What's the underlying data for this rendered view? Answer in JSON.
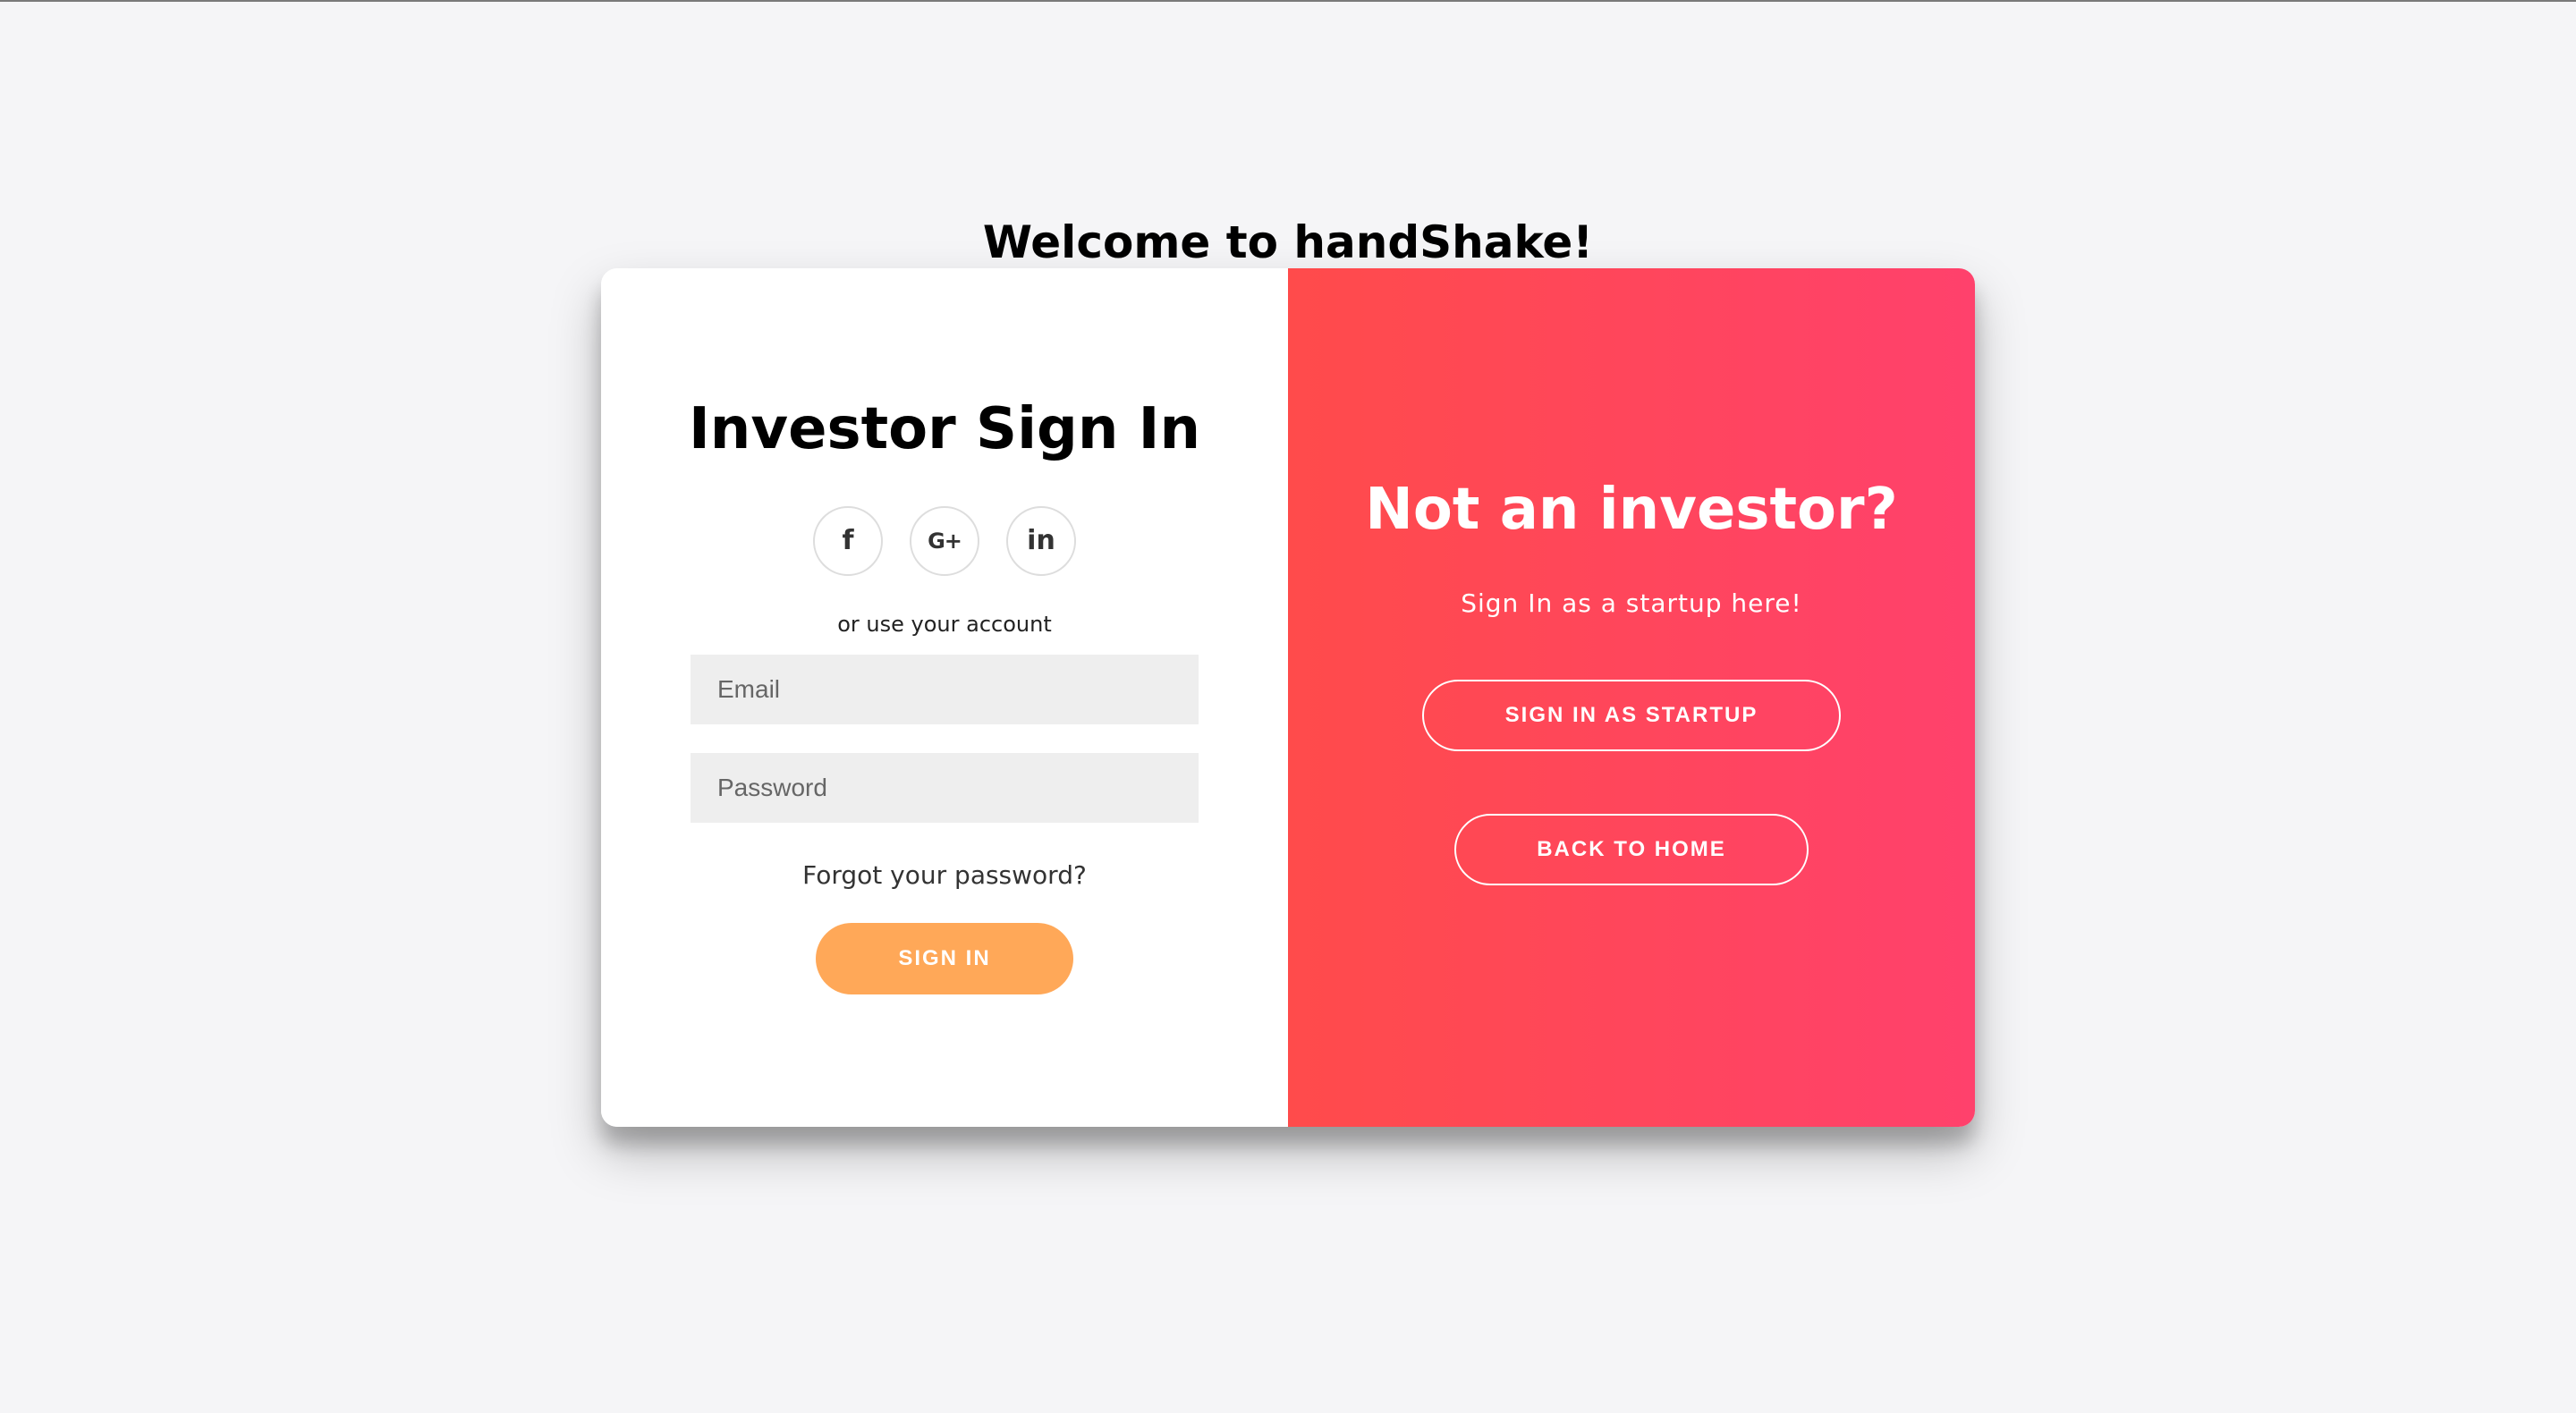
{
  "page": {
    "welcome_title": "Welcome to handShake!"
  },
  "signin_panel": {
    "title": "Investor Sign In",
    "social_buttons": [
      {
        "icon": "facebook-icon",
        "label": "f"
      },
      {
        "icon": "google-plus-icon",
        "label": "G+"
      },
      {
        "icon": "linkedin-icon",
        "label": "in"
      }
    ],
    "alt_text": "or use your account",
    "email_placeholder": "Email",
    "password_placeholder": "Password",
    "forgot_password": "Forgot your password?",
    "submit_label": "SIGN IN"
  },
  "overlay_panel": {
    "title": "Not an investor?",
    "subtitle": "Sign In as a startup here!",
    "startup_button_label": "SIGN IN AS STARTUP",
    "home_button_label": "BACK TO HOME"
  },
  "colors": {
    "background": "#f5f5f7",
    "gradient_start": "#ff4b4b",
    "gradient_end": "#ff416c",
    "signin_button": "#ffa858",
    "input_background": "#eeeeee"
  }
}
